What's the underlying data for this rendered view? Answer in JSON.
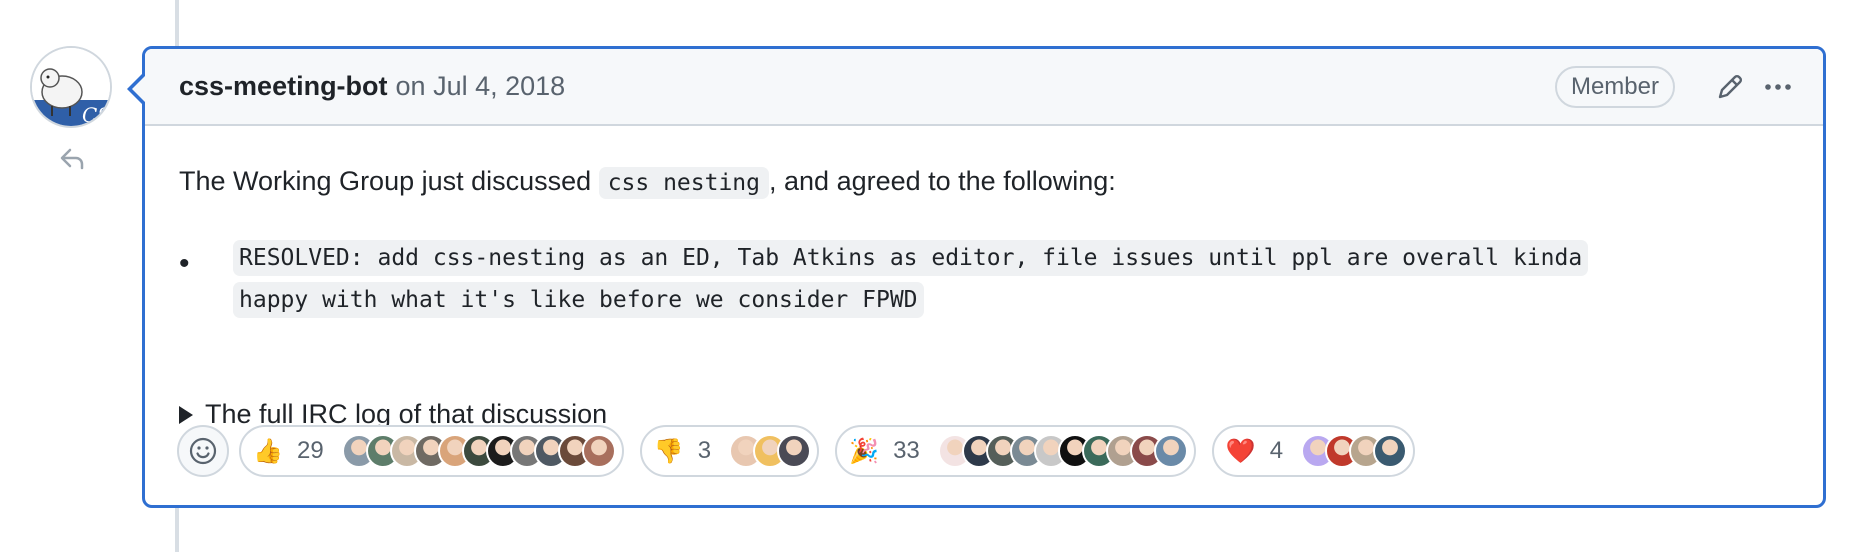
{
  "comment": {
    "author": "css-meeting-bot",
    "date": "on Jul 4, 2018",
    "badge": "Member",
    "avatar_text": "CSS",
    "intro_before": "The Working Group just discussed ",
    "intro_code": "css nesting",
    "intro_after": ", and agreed to the following:",
    "resolution": "RESOLVED: add css-nesting as an ED, Tab Atkins as editor, file issues until ppl are overall kinda happy with what it's like before we consider FPWD",
    "details_summary": "The full IRC log of that discussion"
  },
  "icons": {
    "edit": "pencil-icon",
    "more": "kebab-horizontal-icon",
    "reply": "reply-icon",
    "add_reaction": "smiley-icon"
  },
  "reactions": [
    {
      "emoji": "👍",
      "name": "thumbs-up",
      "count": "29",
      "faces": [
        "#8a9aa8",
        "#5d7d6a",
        "#c9b8a4",
        "#6f6a63",
        "#d9a47a",
        "#3c4a3e",
        "#1c1c1c",
        "#777777",
        "#4f5963",
        "#6b4a3a",
        "#a86f5d"
      ]
    },
    {
      "emoji": "👎",
      "name": "thumbs-down",
      "count": "3",
      "faces": [
        "#e8c7b0",
        "#f0c060",
        "#4a4a55"
      ]
    },
    {
      "emoji": "🎉",
      "name": "hooray",
      "count": "33",
      "faces": [
        "#f3e3e3",
        "#2e3a4a",
        "#555f5a",
        "#7a8a94",
        "#c8c8c8",
        "#101010",
        "#3b6a5a",
        "#b0a090",
        "#8a4a4a",
        "#6a8aa8"
      ]
    },
    {
      "emoji": "❤️",
      "name": "heart",
      "count": "4",
      "faces": [
        "#b9a8f0",
        "#c0392b",
        "#b7a58e",
        "#3a5a70"
      ]
    }
  ],
  "colors": {
    "focus_border": "#2f6fd1",
    "header_bg": "#f6f8fa",
    "timeline": "#d8dee4"
  }
}
